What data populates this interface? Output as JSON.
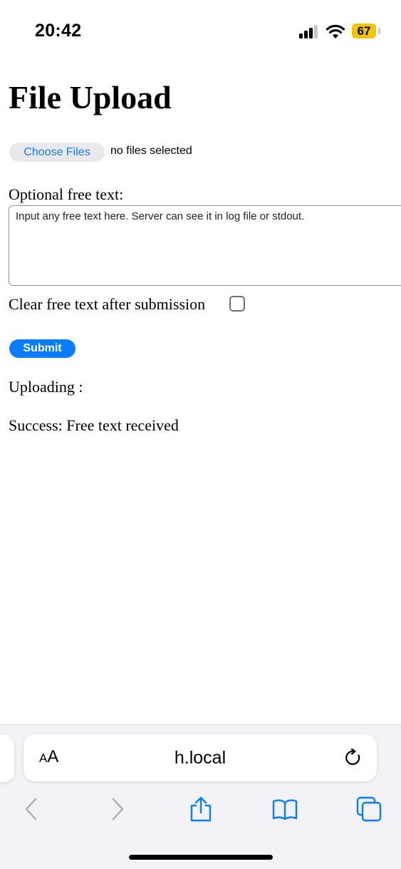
{
  "status_bar": {
    "time": "20:42",
    "battery": "67",
    "battery_color": "#f5c400",
    "signal_icon": "cellular-signal-icon",
    "wifi_icon": "wifi-icon"
  },
  "page": {
    "title": "File Upload",
    "choose_files_label": "Choose Files",
    "file_status": "no files selected",
    "free_text_label": "Optional free text:",
    "free_text_placeholder": "Input any free text here. Server can see it in log file or stdout.",
    "free_text_value": "",
    "clear_label": "Clear free text after submission",
    "clear_checked": false,
    "submit_label": "Submit",
    "uploading_text": "Uploading :",
    "success_text": "Success: Free text received"
  },
  "browser": {
    "text_size_label_small": "A",
    "text_size_label_large": "A",
    "url": "h.local",
    "reload_icon": "reload-icon",
    "toolbar": [
      "back-icon",
      "forward-icon",
      "share-icon",
      "bookmarks-icon",
      "tabs-icon"
    ],
    "accent_color": "#0a7cff"
  }
}
